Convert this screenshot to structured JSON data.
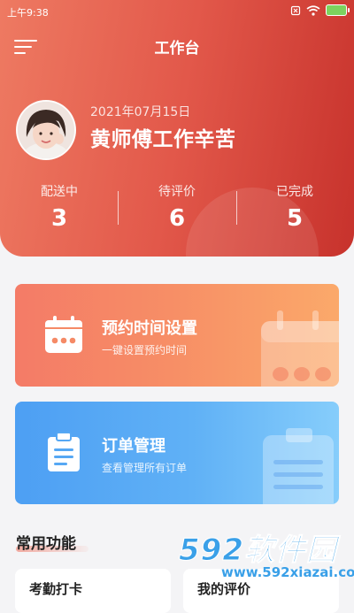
{
  "status_bar": {
    "time": "上午9:38"
  },
  "header": {
    "title": "工作台",
    "date": "2021年07月15日",
    "greeting": "黄师傅工作辛苦",
    "stats": [
      {
        "label": "配送中",
        "value": "3"
      },
      {
        "label": "待评价",
        "value": "6"
      },
      {
        "label": "已完成",
        "value": "5"
      }
    ]
  },
  "cards": [
    {
      "title": "预约时间设置",
      "subtitle": "一键设置预约时间",
      "icon": "calendar-icon"
    },
    {
      "title": "订单管理",
      "subtitle": "查看管理所有订单",
      "icon": "clipboard-icon"
    }
  ],
  "section": {
    "title": "常用功能",
    "items": [
      {
        "label": "考勤打卡"
      },
      {
        "label": "我的评价"
      }
    ]
  },
  "watermark": {
    "main": "592软件园",
    "sub": "www.592xiazai.com"
  },
  "colors": {
    "header_gradient_start": "#ee7a62",
    "header_gradient_end": "#c7322c",
    "card_orange": "#f78f66",
    "card_blue": "#60b1f6",
    "battery": "#7cd35e",
    "watermark_blue": "#3aa0e8",
    "watermark_red": "#e8463e"
  }
}
